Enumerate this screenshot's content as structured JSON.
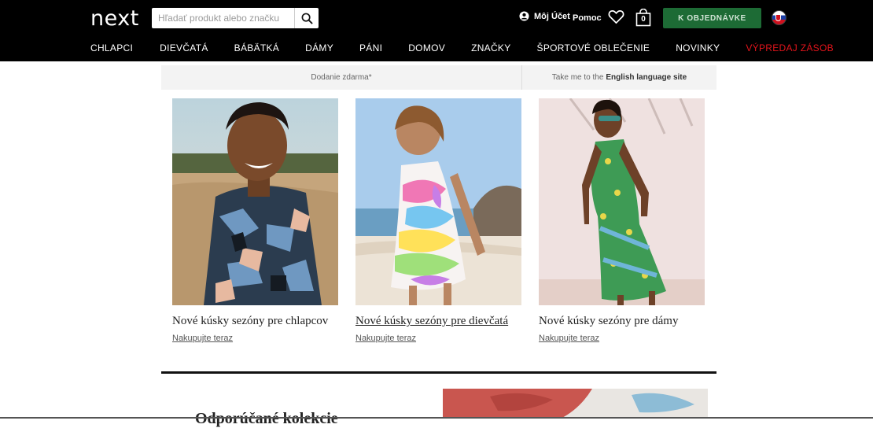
{
  "header": {
    "logo": "next",
    "search_placeholder": "Hľadať produkt alebo značku",
    "account_label": "Môj Účet",
    "help_label": "Pomoc",
    "bag_count": "0",
    "checkout_label": "K OBJEDNÁVKE"
  },
  "nav": {
    "items": [
      {
        "label": "CHLAPCI"
      },
      {
        "label": "DIEVČATÁ"
      },
      {
        "label": "BÁBÄTKÁ"
      },
      {
        "label": "DÁMY"
      },
      {
        "label": "PÁNI"
      },
      {
        "label": "DOMOV"
      },
      {
        "label": "ZNAČKY"
      },
      {
        "label": "ŠPORTOVÉ OBLEČENIE"
      },
      {
        "label": "NOVINKY"
      },
      {
        "label": "VÝPREDAJ ZÁSOB"
      }
    ]
  },
  "strip": {
    "delivery": "Dodanie zdarma*",
    "english_prefix": "Take me to the",
    "english_link": "English language site"
  },
  "cards": [
    {
      "title": "Nové kúsky sezóny pre chlapcov",
      "link": "Nakupujte teraz"
    },
    {
      "title": "Nové kúsky sezóny pre dievčatá",
      "link": "Nakupujte teraz"
    },
    {
      "title": "Nové kúsky sezóny pre dámy",
      "link": "Nakupujte teraz"
    }
  ],
  "bottom": {
    "heading": "Odporúčané kolekcie"
  },
  "colors": {
    "header_bg": "#000000",
    "checkout_bg": "#1d6b35",
    "sale_red": "#e3141b"
  }
}
